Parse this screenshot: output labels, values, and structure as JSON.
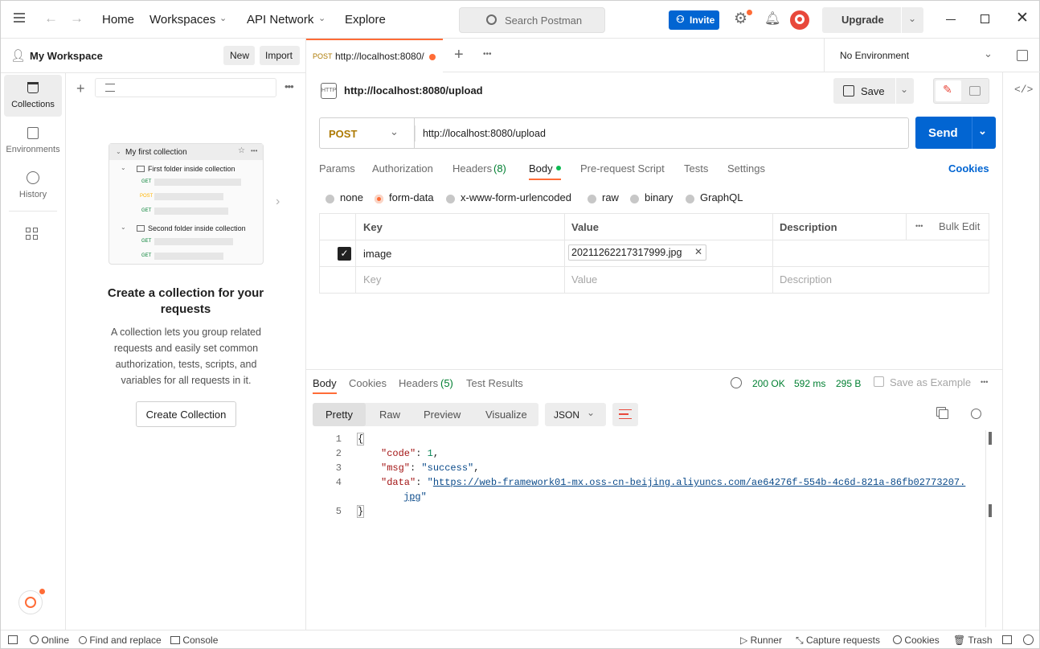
{
  "topbar": {
    "home": "Home",
    "workspaces": "Workspaces",
    "api_network": "API Network",
    "explore": "Explore",
    "search_placeholder": "Search Postman",
    "invite": "Invite",
    "upgrade": "Upgrade"
  },
  "workspace": {
    "name": "My Workspace",
    "new": "New",
    "import": "Import"
  },
  "rail": [
    {
      "label": "Collections",
      "icon": "collections-icon"
    },
    {
      "label": "Environments",
      "icon": "environments-icon"
    },
    {
      "label": "History",
      "icon": "history-icon"
    }
  ],
  "empty_state": {
    "collection_name": "My first collection",
    "folder1": "First folder inside collection",
    "folder2": "Second folder inside collection",
    "get": "GET",
    "post": "POST",
    "title": "Create a collection for your requests",
    "desc": "A collection lets you group related requests and easily set common authorization, tests, scripts, and variables for all requests in it.",
    "button": "Create Collection"
  },
  "tab": {
    "method": "POST",
    "url": "http://localhost:8080/"
  },
  "environment": "No Environment",
  "request": {
    "title": "http://localhost:8080/upload",
    "save": "Save",
    "method": "POST",
    "url": "http://localhost:8080/upload",
    "send": "Send"
  },
  "req_tabs": [
    "Params",
    "Authorization",
    "Headers",
    "(8)",
    "Body",
    "Pre-request Script",
    "Tests",
    "Settings"
  ],
  "cookies_link": "Cookies",
  "body_modes": [
    "none",
    "form-data",
    "x-www-form-urlencoded",
    "raw",
    "binary",
    "GraphQL"
  ],
  "form_table": {
    "headers": [
      "Key",
      "Value",
      "Description",
      "Bulk Edit"
    ],
    "row": {
      "key": "image",
      "value": "20211262217317999.jpg"
    },
    "placeholders": {
      "key": "Key",
      "value": "Value",
      "description": "Description"
    }
  },
  "response": {
    "tabs": [
      "Body",
      "Cookies",
      "Headers",
      "(5)",
      "Test Results"
    ],
    "status": "200 OK",
    "time": "592 ms",
    "size": "295 B",
    "save_example": "Save as Example",
    "views": [
      "Pretty",
      "Raw",
      "Preview",
      "Visualize"
    ],
    "format": "JSON",
    "lines": [
      "1",
      "2",
      "3",
      "4",
      "5"
    ],
    "code": {
      "open": "{",
      "k_code": "\"code\"",
      "v_code": "1",
      "k_msg": "\"msg\"",
      "v_msg": "\"success\"",
      "k_data": "\"data\"",
      "v_data_1": "https://web-framework01-mx.oss-cn-beijing.aliyuncs.com/ae64276f-554b-4c6d-821a-86fb02773207.",
      "v_data_2": "jpg",
      "close": "}"
    }
  },
  "statusbar": {
    "online": "Online",
    "find": "Find and replace",
    "console": "Console",
    "runner": "Runner",
    "capture": "Capture requests",
    "cookies": "Cookies",
    "trash": "Trash"
  },
  "colors": {
    "accent": "#ff6c37",
    "blue": "#0265d2",
    "ok": "#007f31"
  }
}
